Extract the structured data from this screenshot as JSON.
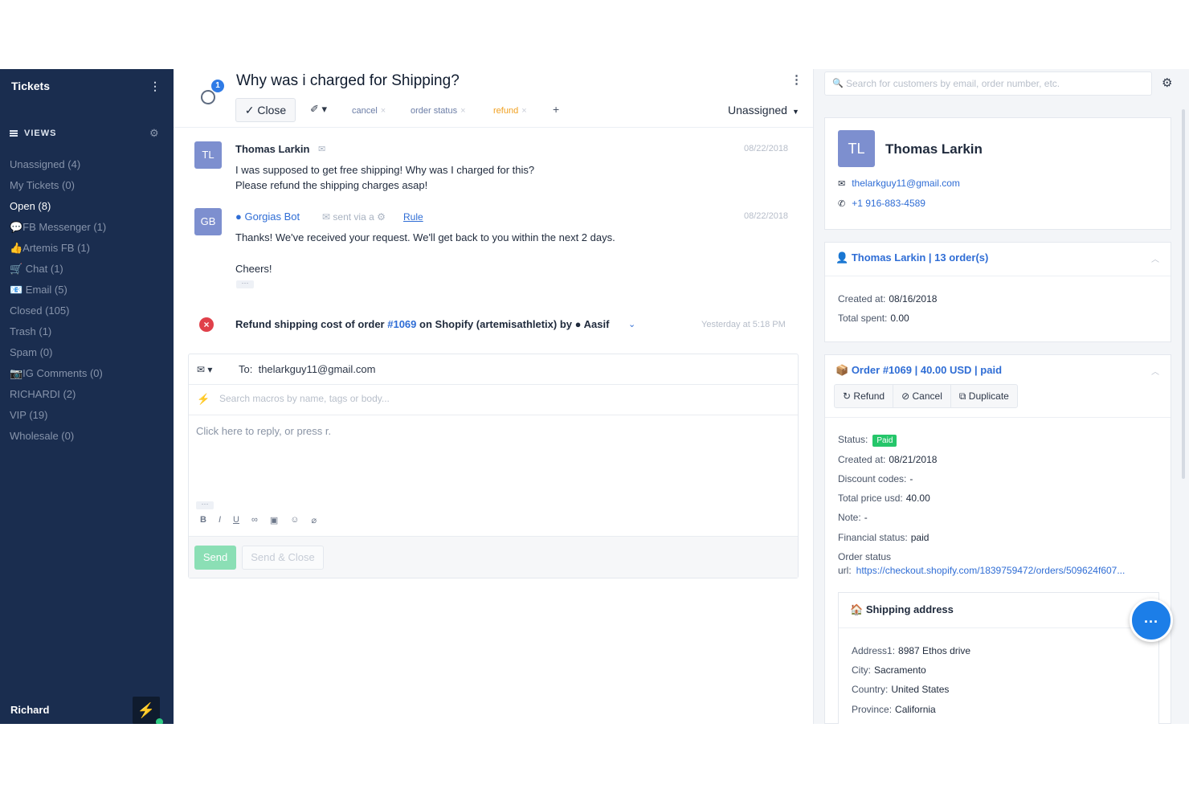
{
  "sidebar": {
    "title": "Tickets",
    "views_label": "VIEWS",
    "items": [
      {
        "label": "Unassigned (4)"
      },
      {
        "label": "My Tickets (0)"
      },
      {
        "label": "Open (8)"
      },
      {
        "label": "💬FB Messenger (1)"
      },
      {
        "label": "👍Artemis FB (1)"
      },
      {
        "label": "🛒 Chat (1)"
      },
      {
        "label": "📧 Email (5)"
      },
      {
        "label": "Closed (105)"
      },
      {
        "label": "Trash (1)"
      },
      {
        "label": "Spam (0)"
      },
      {
        "label": "📷IG Comments (0)"
      },
      {
        "label": "RICHARDI (2)"
      },
      {
        "label": "VIP (19)"
      },
      {
        "label": "Wholesale (0)"
      }
    ],
    "user_name": "Richard"
  },
  "ticket": {
    "history_count": "1",
    "title": "Why was i charged for Shipping?",
    "close_label": "Close",
    "tags": [
      "cancel",
      "order status",
      "refund"
    ],
    "assignee": "Unassigned"
  },
  "messages": [
    {
      "avatar": "TL",
      "author": "Thomas Larkin",
      "date": "08/22/2018",
      "lines": [
        "I was supposed to get free shipping! Why was I charged for this?",
        "Please refund the shipping charges asap!"
      ]
    },
    {
      "avatar": "GB",
      "author": "Gorgias Bot",
      "sent_via": "sent via a",
      "rule": "Rule",
      "date": "08/22/2018",
      "lines": [
        "Thanks! We've received your request. We'll get back to you within the next 2 days.",
        "Cheers!"
      ]
    }
  ],
  "event": {
    "text_before": "Refund shipping cost of order",
    "order_link": "#1069",
    "text_mid": "on",
    "platform": "Shopify (artemisathletix)",
    "text_by": "by",
    "agent": "Aasif",
    "date": "Yesterday at 5:18 PM"
  },
  "composer": {
    "to_label": "To:",
    "to_value": "thelarkguy11@gmail.com",
    "macro_placeholder": "Search macros by name, tags or body...",
    "reply_placeholder": "Click here to reply, or press r.",
    "send_label": "Send",
    "send_close_label": "Send & Close"
  },
  "right": {
    "search_placeholder": "Search for customers by email, order number, etc.",
    "customer": {
      "initials": "TL",
      "name": "Thomas Larkin",
      "email": "thelarkguy11@gmail.com",
      "phone": "+1 916-883-4589"
    },
    "shopify": {
      "title": "Thomas Larkin | 13 order(s)",
      "created_label": "Created at:",
      "created_value": "08/16/2018",
      "spent_label": "Total spent:",
      "spent_value": "0.00"
    },
    "order": {
      "title": "Order #1069 | 40.00 USD | paid",
      "actions": [
        "Refund",
        "Cancel",
        "Duplicate"
      ],
      "status_label": "Status:",
      "status_value": "Paid",
      "created_label": "Created at:",
      "created_value": "08/21/2018",
      "discount_label": "Discount codes:",
      "discount_value": "-",
      "total_label": "Total price usd:",
      "total_value": "40.00",
      "note_label": "Note:",
      "note_value": "-",
      "financial_label": "Financial status:",
      "financial_value": "paid",
      "url_label_1": "Order status",
      "url_label_2": "url:",
      "url_value": "https://checkout.shopify.com/1839759472/orders/509624f607..."
    },
    "shipping": {
      "title": "Shipping address",
      "address1_label": "Address1:",
      "address1_value": "8987 Ethos drive",
      "city_label": "City:",
      "city_value": "Sacramento",
      "country_label": "Country:",
      "country_value": "United States",
      "province_label": "Province:",
      "province_value": "California"
    }
  },
  "colors": {
    "sidebar_bg": "#1a2d4f",
    "link": "#2f6dd5",
    "refund_tag": "#f0a020",
    "paid": "#25c66a",
    "chat_fab": "#1c7ee8"
  }
}
